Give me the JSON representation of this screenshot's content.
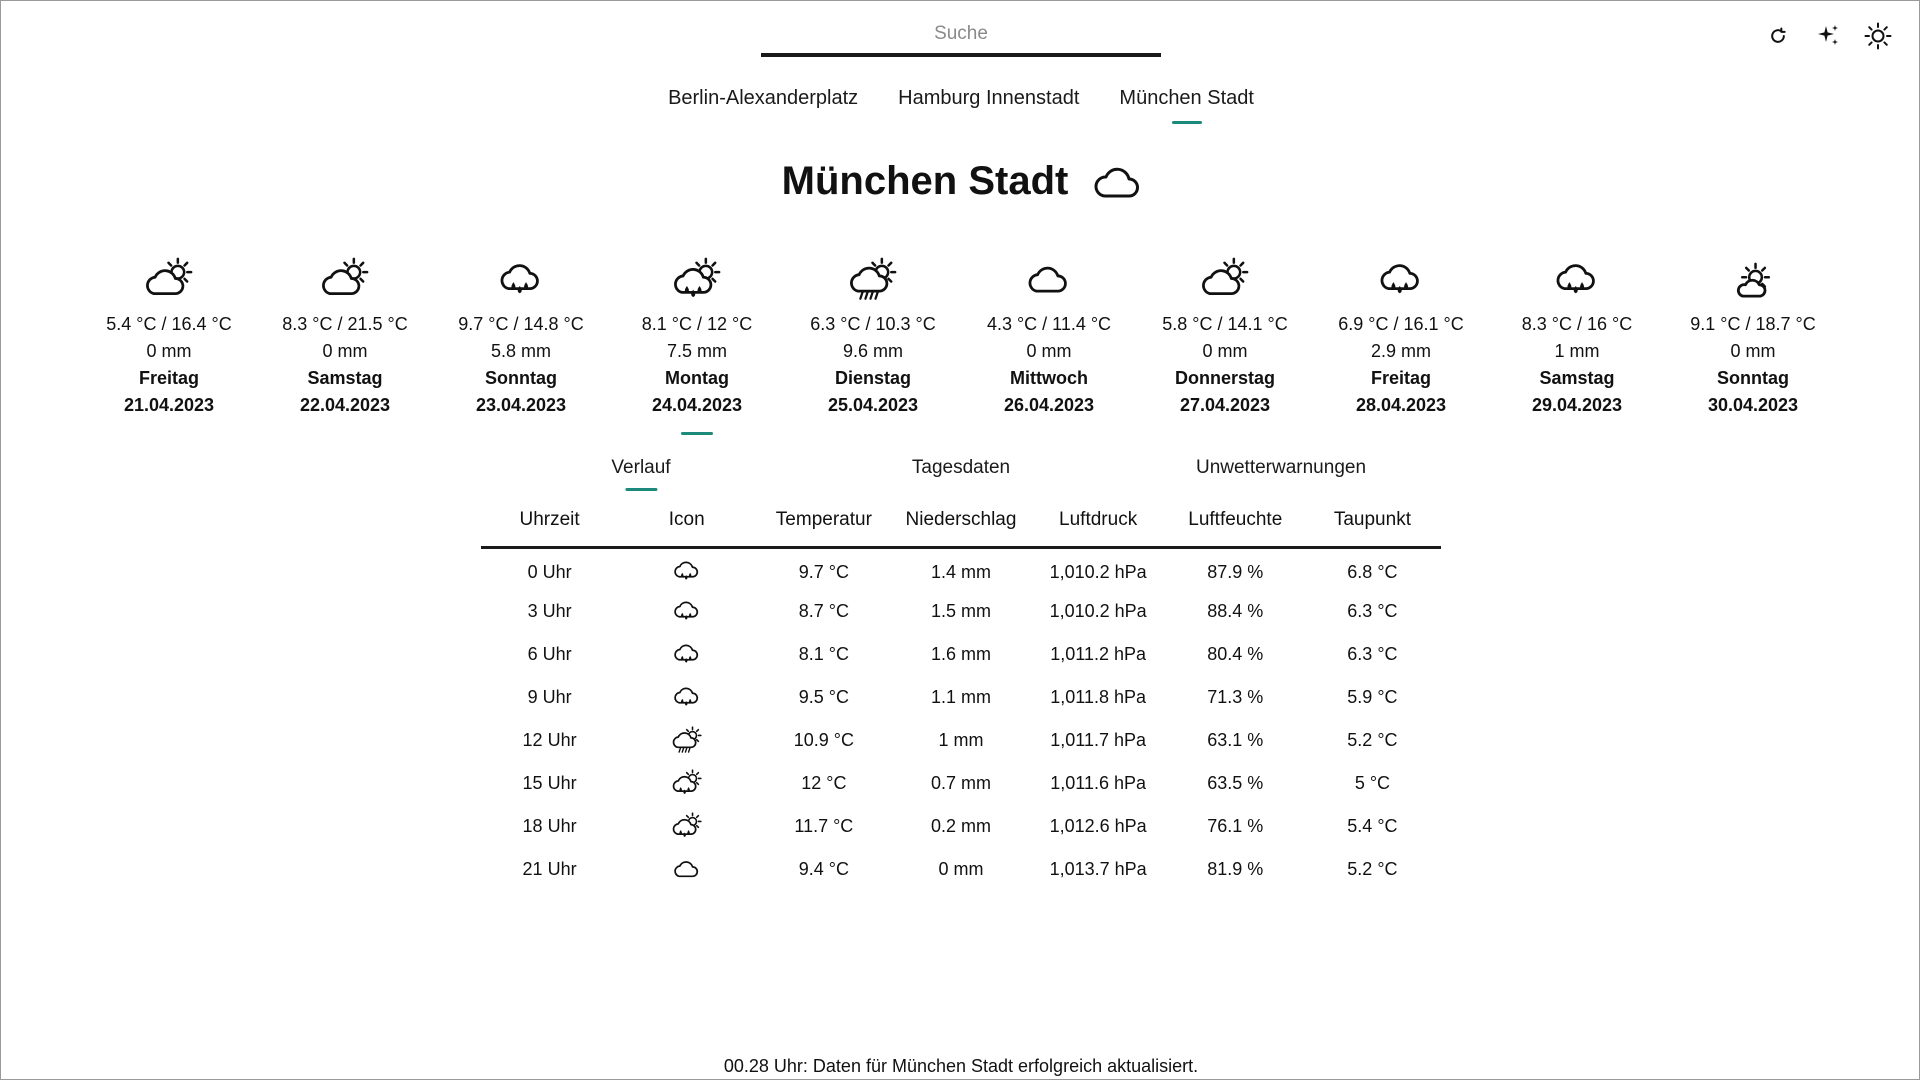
{
  "search": {
    "placeholder": "Suche"
  },
  "toolbar": {
    "refresh_icon": "refresh-icon",
    "sparkle_icon": "sparkle-icon",
    "theme_icon": "sun-icon"
  },
  "locations": [
    {
      "label": "Berlin-Alexanderplatz",
      "active": false
    },
    {
      "label": "Hamburg Innenstadt",
      "active": false
    },
    {
      "label": "München Stadt",
      "active": true
    }
  ],
  "title": {
    "text": "München Stadt",
    "icon": "cloud-icon"
  },
  "forecast": [
    {
      "icon": "partly-cloudy",
      "temp": "5.4 °C / 16.4 °C",
      "precip": "0 mm",
      "weekday": "Freitag",
      "date": "21.04.2023"
    },
    {
      "icon": "partly-cloudy",
      "temp": "8.3 °C / 21.5 °C",
      "precip": "0 mm",
      "weekday": "Samstag",
      "date": "22.04.2023"
    },
    {
      "icon": "rain-cloud",
      "temp": "9.7 °C / 14.8 °C",
      "precip": "5.8 mm",
      "weekday": "Sonntag",
      "date": "23.04.2023"
    },
    {
      "icon": "sun-rain",
      "temp": "8.1 °C / 12 °C",
      "precip": "7.5 mm",
      "weekday": "Montag",
      "date": "24.04.2023",
      "active": true
    },
    {
      "icon": "sun-showers",
      "temp": "6.3 °C / 10.3 °C",
      "precip": "9.6 mm",
      "weekday": "Dienstag",
      "date": "25.04.2023"
    },
    {
      "icon": "cloud",
      "temp": "4.3 °C / 11.4 °C",
      "precip": "0 mm",
      "weekday": "Mittwoch",
      "date": "26.04.2023"
    },
    {
      "icon": "partly-cloudy",
      "temp": "5.8 °C / 14.1 °C",
      "precip": "0 mm",
      "weekday": "Donnerstag",
      "date": "27.04.2023"
    },
    {
      "icon": "rain-cloud",
      "temp": "6.9 °C / 16.1 °C",
      "precip": "2.9 mm",
      "weekday": "Freitag",
      "date": "28.04.2023"
    },
    {
      "icon": "rain-cloud",
      "temp": "8.3 °C / 16 °C",
      "precip": "1 mm",
      "weekday": "Samstag",
      "date": "29.04.2023"
    },
    {
      "icon": "sunny-cloud",
      "temp": "9.1 °C / 18.7 °C",
      "precip": "0 mm",
      "weekday": "Sonntag",
      "date": "30.04.2023"
    }
  ],
  "detail_tabs": [
    {
      "label": "Verlauf",
      "active": true
    },
    {
      "label": "Tagesdaten",
      "active": false
    },
    {
      "label": "Unwetterwarnungen",
      "active": false
    }
  ],
  "hourly": {
    "headers": [
      "Uhrzeit",
      "Icon",
      "Temperatur",
      "Niederschlag",
      "Luftdruck",
      "Luftfeuchte",
      "Taupunkt"
    ],
    "rows": [
      {
        "time": "0 Uhr",
        "icon": "rain-cloud",
        "temp": "9.7 °C",
        "precip": "1.4 mm",
        "pressure": "1,010.2 hPa",
        "humidity": "87.9 %",
        "dew": "6.8 °C"
      },
      {
        "time": "3 Uhr",
        "icon": "rain-cloud",
        "temp": "8.7 °C",
        "precip": "1.5 mm",
        "pressure": "1,010.2 hPa",
        "humidity": "88.4 %",
        "dew": "6.3 °C"
      },
      {
        "time": "6 Uhr",
        "icon": "rain-cloud",
        "temp": "8.1 °C",
        "precip": "1.6 mm",
        "pressure": "1,011.2 hPa",
        "humidity": "80.4 %",
        "dew": "6.3 °C"
      },
      {
        "time": "9 Uhr",
        "icon": "rain-cloud",
        "temp": "9.5 °C",
        "precip": "1.1 mm",
        "pressure": "1,011.8 hPa",
        "humidity": "71.3 %",
        "dew": "5.9 °C"
      },
      {
        "time": "12 Uhr",
        "icon": "sun-showers",
        "temp": "10.9 °C",
        "precip": "1 mm",
        "pressure": "1,011.7 hPa",
        "humidity": "63.1 %",
        "dew": "5.2 °C"
      },
      {
        "time": "15 Uhr",
        "icon": "sun-rain",
        "temp": "12 °C",
        "precip": "0.7 mm",
        "pressure": "1,011.6 hPa",
        "humidity": "63.5 %",
        "dew": "5 °C"
      },
      {
        "time": "18 Uhr",
        "icon": "sun-rain",
        "temp": "11.7 °C",
        "precip": "0.2 mm",
        "pressure": "1,012.6 hPa",
        "humidity": "76.1 %",
        "dew": "5.4 °C"
      },
      {
        "time": "21 Uhr",
        "icon": "cloud",
        "temp": "9.4 °C",
        "precip": "0 mm",
        "pressure": "1,013.7 hPa",
        "humidity": "81.9 %",
        "dew": "5.2 °C"
      }
    ]
  },
  "status": "00.28 Uhr: Daten für München Stadt erfolgreich aktualisiert.",
  "colors": {
    "accent": "#1b8a7a",
    "text": "#111111"
  }
}
